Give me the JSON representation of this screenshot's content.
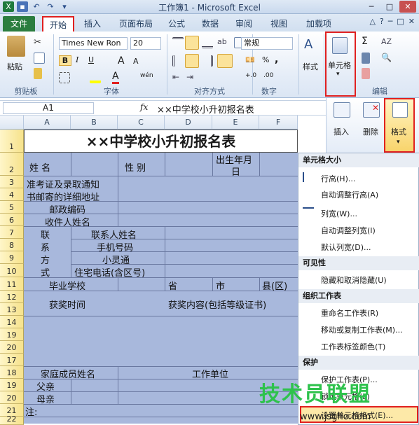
{
  "window": {
    "title": "工作簿1 - Microsoft Excel",
    "min": "─",
    "max": "□",
    "close": "✕"
  },
  "tabs": {
    "file": "文件",
    "home": "开始",
    "insert": "插入",
    "layout": "页面布局",
    "formulas": "公式",
    "data": "数据",
    "review": "审阅",
    "view": "视图",
    "addins": "加载项"
  },
  "ribbon": {
    "paste": "粘贴",
    "clipboard": "剪贴板",
    "font_name": "Times New Ron",
    "font_size": "20",
    "font_group": "字体",
    "bold": "B",
    "italic": "I",
    "underline": "U",
    "grow": "A",
    "shrink": "A",
    "wen": "wén",
    "align_group": "对齐方式",
    "number_format": "常规",
    "number_group": "数字",
    "percent": "%",
    "comma": ",",
    "dec_inc": "+.0",
    "dec_dec": ".00",
    "styles": "样式",
    "cells": "单元格",
    "editing": "编辑",
    "sigma": "Σ",
    "insert": "插入",
    "delete": "删除",
    "format": "格式"
  },
  "formula_bar": {
    "name": "A1",
    "fx": "fx",
    "value": "××中学校小升初报名表"
  },
  "columns": [
    "A",
    "B",
    "C",
    "D",
    "E",
    "F"
  ],
  "rows": [
    "1",
    "2",
    "3",
    "4",
    "5",
    "6",
    "7",
    "8",
    "9",
    "10",
    "11",
    "12",
    "13",
    "14",
    "19",
    "20",
    "17",
    "18",
    "19",
    "20",
    "21",
    "22"
  ],
  "sheet": {
    "title": "××中学校小升初报名表",
    "name": "姓  名",
    "gender": "性  别",
    "birth1": "出生年月",
    "birth2": "日",
    "notice1": "准考证及录取通知",
    "notice2": "书邮寄的详细地址",
    "postcode": "邮政编码",
    "recipient": "收件人姓名",
    "lian": "联",
    "xi": "系",
    "fang": "方",
    "shi": "式",
    "contact_name": "联系人姓名",
    "mobile": "手机号码",
    "phone": "小灵通",
    "home_phone": "住宅电话(含区号)",
    "school": "毕业学校",
    "province": "省",
    "city": "市",
    "district": "县(区)",
    "award_time": "获奖时间",
    "award_content": "获奖内容(包括等级证书)",
    "family": "家庭成员姓名",
    "work": "工作单位",
    "father": "父亲",
    "mother": "母亲",
    "note": "注:"
  },
  "menu": {
    "h_size": "单元格大小",
    "row_height": "行高(H)...",
    "autofit_row": "自动调整行高(A)",
    "col_width": "列宽(W)...",
    "autofit_col": "自动调整列宽(I)",
    "default_width": "默认列宽(D)...",
    "h_visibility": "可见性",
    "hide_unhide": "隐藏和取消隐藏(U)",
    "h_organize": "组织工作表",
    "rename": "重命名工作表(R)",
    "move_copy": "移动或复制工作表(M)...",
    "tab_color": "工作表标签颜色(T)",
    "h_protect": "保护",
    "protect": "保护工作表(P)...",
    "lock": "锁定单元格(L)",
    "format_cells": "设置单元格格式(E)..."
  },
  "watermark": {
    "logo": "技术员联盟",
    "url": "www.jsgho.com"
  },
  "colors": {
    "file_tab": "#2b7d3f",
    "highlight": "#e02020",
    "sheet_fill": "#a8b8dc",
    "row_header": "#f6e28b"
  }
}
